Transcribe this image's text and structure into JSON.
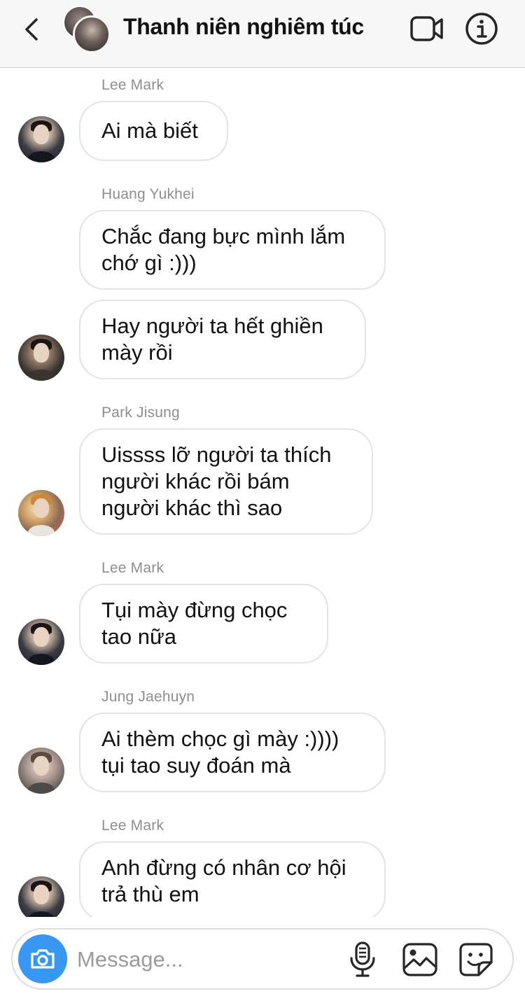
{
  "header": {
    "title": "Thanh niên nghiêm túc",
    "icons": {
      "back": "chevron-left-icon",
      "video": "video-camera-icon",
      "info": "info-icon"
    }
  },
  "messages": [
    {
      "sender": "Lee Mark",
      "bubbles": [
        "Ai mà biết"
      ]
    },
    {
      "sender": "Huang Yukhei",
      "bubbles": [
        "Chắc đang bực mình lắm\nchớ gì :)))",
        "Hay người ta hết ghiền\nmày rồi"
      ]
    },
    {
      "sender": "Park Jisung",
      "bubbles": [
        "Uissss lỡ người ta thích\nngười khác rồi bám\nngười khác thì sao"
      ]
    },
    {
      "sender": "Lee Mark",
      "bubbles": [
        "Tụi mày đừng chọc\ntao nữa"
      ]
    },
    {
      "sender": "Jung Jaehuyn",
      "bubbles": [
        "Ai thèm chọc gì mày :))))\ntụi tao suy đoán mà"
      ]
    },
    {
      "sender": "Lee Mark",
      "bubbles": [
        "Anh đừng có nhân cơ hội\ntrả thù em"
      ]
    }
  ],
  "composer": {
    "placeholder": "Message...",
    "value": "",
    "icons": {
      "camera": "camera-icon",
      "mic": "microphone-icon",
      "gallery": "image-icon",
      "sticker": "sticker-icon"
    },
    "accent_color": "#3897f0"
  }
}
